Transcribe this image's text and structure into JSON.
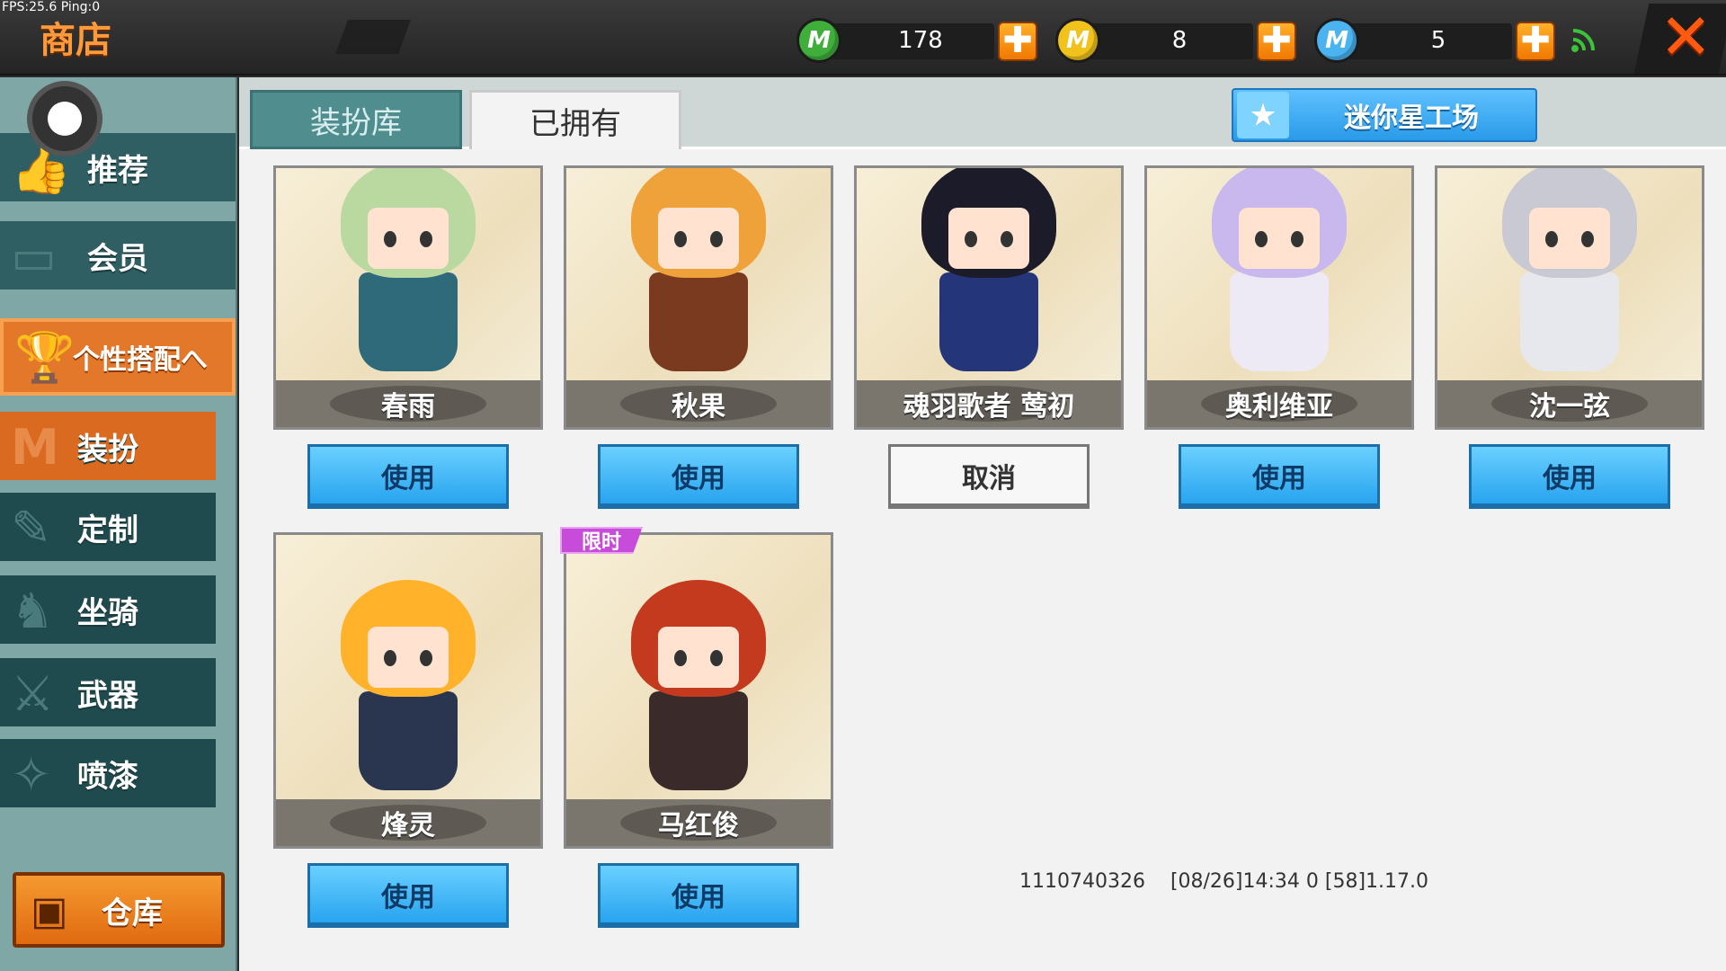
{
  "status": {
    "fps_text": "FPS:25.6  Ping:0"
  },
  "header": {
    "title": "商店",
    "currencies": [
      {
        "name": "mini-bean",
        "value": "178",
        "color": "#3fae3a",
        "glyph": "M"
      },
      {
        "name": "mini-coin",
        "value": "8",
        "color": "#f1c21b",
        "glyph": "M"
      },
      {
        "name": "mini-star",
        "value": "5",
        "color": "#4ab3f0",
        "glyph": "M"
      }
    ],
    "plus_label": "✚",
    "close_label": "✕"
  },
  "sidebar": {
    "items": [
      {
        "label": "推荐",
        "icon": "thumbs-up-icon"
      },
      {
        "label": "会员",
        "icon": "vip-icon"
      },
      {
        "label": "个性搭配へ",
        "icon": "trophy-icon"
      },
      {
        "label": "装扮",
        "icon": "shirt-icon"
      },
      {
        "label": "定制",
        "icon": "pencil-icon"
      },
      {
        "label": "坐骑",
        "icon": "mount-icon"
      },
      {
        "label": "武器",
        "icon": "gun-icon"
      },
      {
        "label": "喷漆",
        "icon": "spray-icon"
      }
    ],
    "warehouse_label": "仓库"
  },
  "tabs": {
    "library": "装扮库",
    "owned": "已拥有"
  },
  "workshop": {
    "label": "迷你星工场",
    "icon": "star-icon"
  },
  "skins": [
    {
      "name": "春雨",
      "action": "使用",
      "limited": "",
      "hair": "#b9d9a0",
      "body": "#2e6a7a"
    },
    {
      "name": "秋果",
      "action": "使用",
      "limited": "",
      "hair": "#f0a23a",
      "body": "#7a3a20"
    },
    {
      "name": "魂羽歌者 莺初",
      "action": "取消",
      "limited": "",
      "hair": "#1b1b2a",
      "body": "#25357a"
    },
    {
      "name": "奥利维亚",
      "action": "使用",
      "limited": "",
      "hair": "#c8b8ee",
      "body": "#eeeaf5"
    },
    {
      "name": "沈一弦",
      "action": "使用",
      "limited": "",
      "hair": "#c9c9d4",
      "body": "#e6e8ee"
    },
    {
      "name": "烽灵",
      "action": "使用",
      "limited": "",
      "hair": "#ffb22a",
      "body": "#2a3550"
    },
    {
      "name": "马红俊",
      "action": "使用",
      "limited": "限时",
      "hair": "#c43a1e",
      "body": "#3a2a2a"
    }
  ],
  "footer": {
    "info": "1110740326    [08/26]14:34 0 [58]1.17.0"
  }
}
